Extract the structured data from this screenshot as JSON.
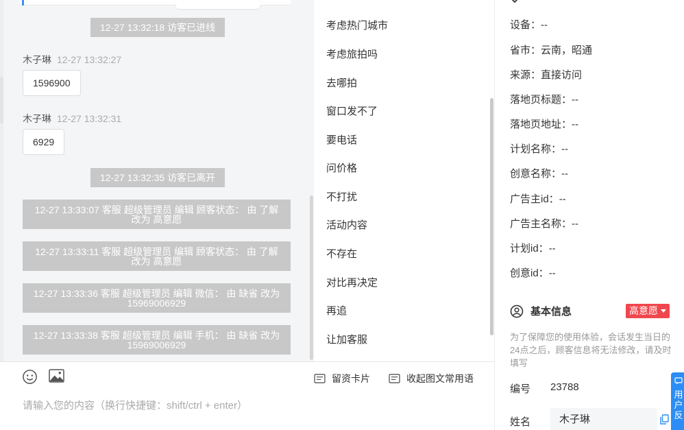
{
  "chat": {
    "system_messages": [
      {
        "time": "12-27 13:32:18",
        "text": "访客已进线"
      },
      {
        "time": "12-27 13:32:35",
        "text": "访客已离开"
      }
    ],
    "messages": [
      {
        "sender": "木子琳",
        "time": "12-27 13:32:27",
        "text": "1596900"
      },
      {
        "sender": "木子琳",
        "time": "12-27 13:32:31",
        "text": "6929"
      }
    ],
    "logs": [
      {
        "line1": "12-27 13:33:07 客服 超级管理员 编辑 顾客状态： 由 了解",
        "line2": "改为 高意愿"
      },
      {
        "line1": "12-27 13:33:11 客服 超级管理员 编辑 顾客状态： 由 了解",
        "line2": "改为 高意愿"
      },
      {
        "line1": "12-27 13:33:36 客服 超级管理员 编辑 微信： 由 缺省 改为",
        "line2": "15969006929"
      },
      {
        "line1": "12-27 13:33:38 客服 超级管理员 编辑 手机： 由 缺省 改为",
        "line2": "15969006929"
      }
    ]
  },
  "phrases": [
    "考虑热门城市",
    "考虑旅拍吗",
    "去哪拍",
    "窗口发不了",
    "要电话",
    "问价格",
    "不打扰",
    "活动内容",
    "不存在",
    "对比再决定",
    "再追",
    "让加客服"
  ],
  "input": {
    "emoji_icon": "smile-icon",
    "image_icon": "image-icon",
    "card_label": "留资卡片",
    "collapse_label": "收起图文常用语",
    "placeholder": "请输入您的内容（换行快捷键：shift/ctrl + enter）"
  },
  "info": {
    "rows": [
      {
        "label": "设备：",
        "value": "--"
      },
      {
        "label": "省市：",
        "value": "云南，昭通"
      },
      {
        "label": "来源：",
        "value": "直接访问"
      },
      {
        "label": "落地页标题：",
        "value": "--"
      },
      {
        "label": "落地页地址：",
        "value": "--"
      },
      {
        "label": "计划名称：",
        "value": "--"
      },
      {
        "label": "创意名称：",
        "value": "--"
      },
      {
        "label": "广告主id：",
        "value": "--"
      },
      {
        "label": "广告主名称：",
        "value": "--"
      },
      {
        "label": "计划id：",
        "value": "--"
      },
      {
        "label": "创意id：",
        "value": "--"
      }
    ],
    "basic_title": "基本信息",
    "status_badge": "高意愿",
    "notice": "为了保障您的使用体验，会话发生当日的24点之后，顾客信息将无法修改，请及时填写",
    "id_label": "编号",
    "id_value": "23788",
    "name_label": "姓名",
    "name_value": "木子琳",
    "float_tab_text": "用户反",
    "accent_color": "#2b8df5",
    "badge_color": "#f0474e"
  }
}
